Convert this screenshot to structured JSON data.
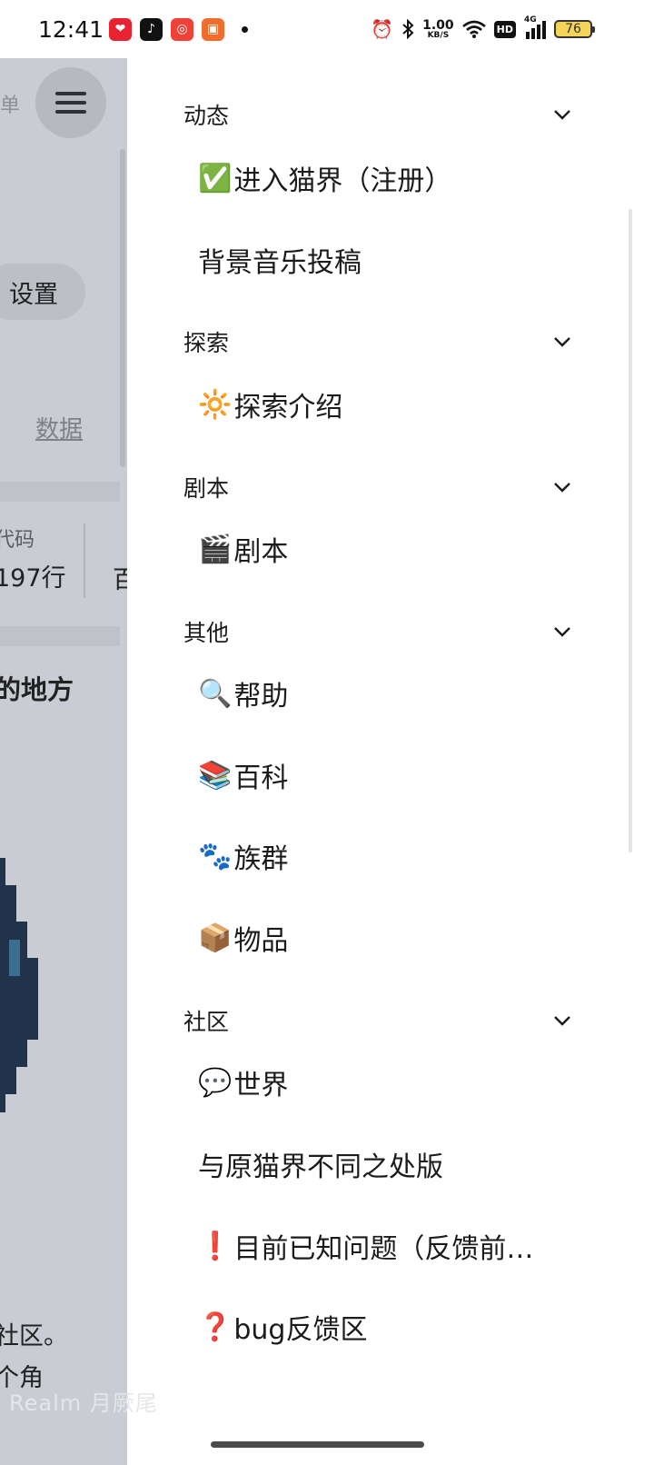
{
  "status_bar": {
    "time": "12:41",
    "net_speed_value": "1.00",
    "net_speed_unit": "KB/S",
    "hd_label": "HD",
    "signal_label": "4G",
    "battery_level": "76",
    "icons": [
      "app-icon-red",
      "tiktok-icon",
      "netease-music-icon",
      "app-icon-orange",
      "alarm-icon",
      "bluetooth-icon",
      "wifi-icon",
      "signal-icon",
      "battery-icon"
    ]
  },
  "background_page": {
    "menu_text": "单",
    "settings_label": "设置",
    "data_link": "数据",
    "code_label": "代码",
    "lines_value": "197行",
    "lines_next": "百",
    "place_heading": "的地方",
    "community_text": "社区。",
    "corner_text": "个角"
  },
  "drawer": {
    "sections": [
      {
        "title": "动态",
        "items": [
          {
            "icon": "✅",
            "label": "进入猫界（注册）"
          },
          {
            "icon": "",
            "label": "背景音乐投稿"
          }
        ]
      },
      {
        "title": "探索",
        "items": [
          {
            "icon": "🔆",
            "label": "探索介绍"
          }
        ]
      },
      {
        "title": "剧本",
        "items": [
          {
            "icon": "🎬",
            "label": "剧本"
          }
        ]
      },
      {
        "title": "其他",
        "items": [
          {
            "icon": "🔍",
            "label": "帮助"
          },
          {
            "icon": "📚",
            "label": "百科"
          },
          {
            "icon": "🐾",
            "label": "族群"
          },
          {
            "icon": "📦",
            "label": "物品"
          }
        ]
      },
      {
        "title": "社区",
        "items": [
          {
            "icon": "💬",
            "label": "世界"
          },
          {
            "icon": "",
            "label": "与原猫界不同之处版"
          },
          {
            "icon": "❗",
            "label": "目前已知问题（反馈前…"
          },
          {
            "icon": "❓",
            "label": "bug反馈区"
          }
        ]
      }
    ]
  },
  "watermark": "Realm 月厥尾",
  "colors": {
    "drawer_bg": "#ffffff",
    "scrim": "#c9ccd2",
    "text": "#1b1b1b"
  }
}
